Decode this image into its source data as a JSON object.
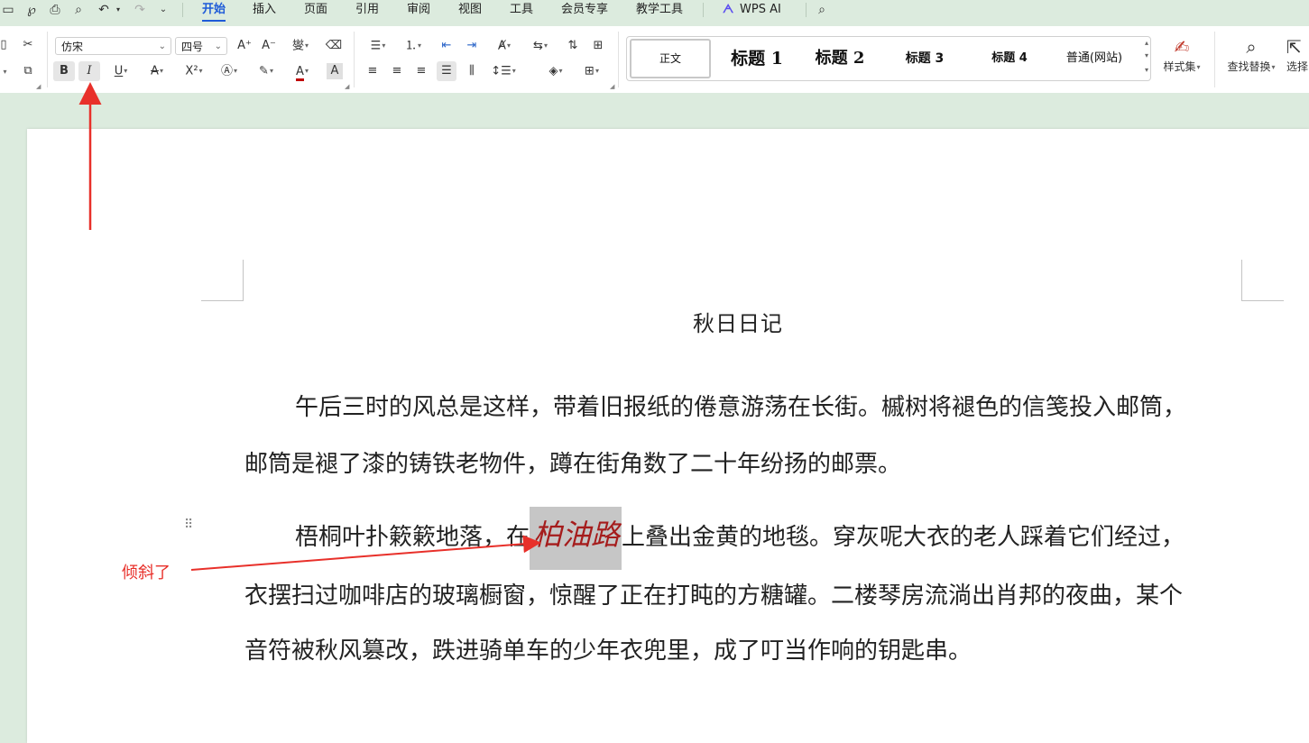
{
  "menu": {
    "tabs": [
      "开始",
      "插入",
      "页面",
      "引用",
      "审阅",
      "视图",
      "工具",
      "会员专享",
      "教学工具"
    ],
    "active_tab": "开始",
    "wps_ai": "WPS AI"
  },
  "ribbon": {
    "font_name": "仿宋",
    "font_size": "四号",
    "bold_label": "B",
    "italic_label": "I",
    "underline_label": "U",
    "styles": [
      "正文",
      "标题 1",
      "标题 2",
      "标题 3",
      "标题 4",
      "普通(网站)"
    ],
    "style_set_label": "样式集",
    "find_replace_label": "查找替换",
    "select_label": "选择"
  },
  "document": {
    "title": "秋日日记",
    "para1_line1": "午后三时的风总是这样，带着旧报纸的倦意游荡在长街。槭树将褪色的信笺投入邮筒，",
    "para1_line2": "邮筒是褪了漆的铸铁老物件，蹲在街角数了二十年纷扬的邮票。",
    "para2_line1_a": "梧桐叶扑簌簌地落，在",
    "para2_line1_highlight": "柏油路",
    "para2_line1_b": "上叠出金黄的地毯。穿灰呢大衣的老人踩着它们经过，",
    "para2_line2": "衣摆扫过咖啡店的玻璃橱窗，惊醒了正在打盹的方糖罐。二楼琴房流淌出肖邦的夜曲，某个",
    "para2_line3": "音符被秋风篡改，跌进骑单车的少年衣兜里，成了叮当作响的钥匙串。"
  },
  "annotation": {
    "label": "倾斜了",
    "color": "#e8302a"
  }
}
